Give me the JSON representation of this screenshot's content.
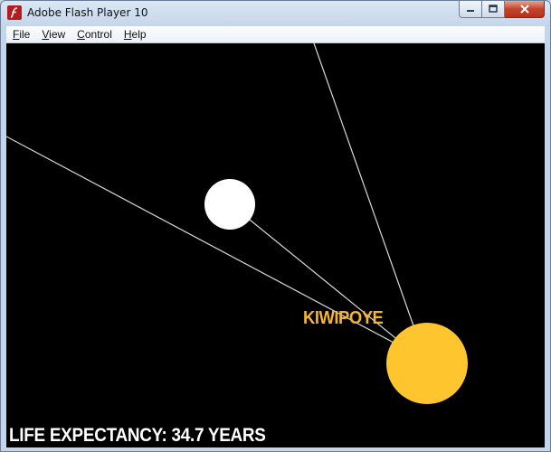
{
  "window": {
    "title": "Adobe Flash Player 10",
    "icon": "flash-player-icon",
    "controls": [
      "minimize-icon",
      "maximize-icon",
      "close-icon"
    ]
  },
  "menu": {
    "items": [
      {
        "label": "File",
        "accel": "F",
        "rest": "ile"
      },
      {
        "label": "View",
        "accel": "V",
        "rest": "iew"
      },
      {
        "label": "Control",
        "accel": "C",
        "rest": "ontrol"
      },
      {
        "label": "Help",
        "accel": "H",
        "rest": "elp"
      }
    ]
  },
  "stage": {
    "background": "#000000",
    "country_name": "KIWIPOYE",
    "country_color": "#f5b52b",
    "life_expectancy_text": "LIFE EXPECTANCY: 34.7 YEARS",
    "node_color": "#ffffff"
  }
}
